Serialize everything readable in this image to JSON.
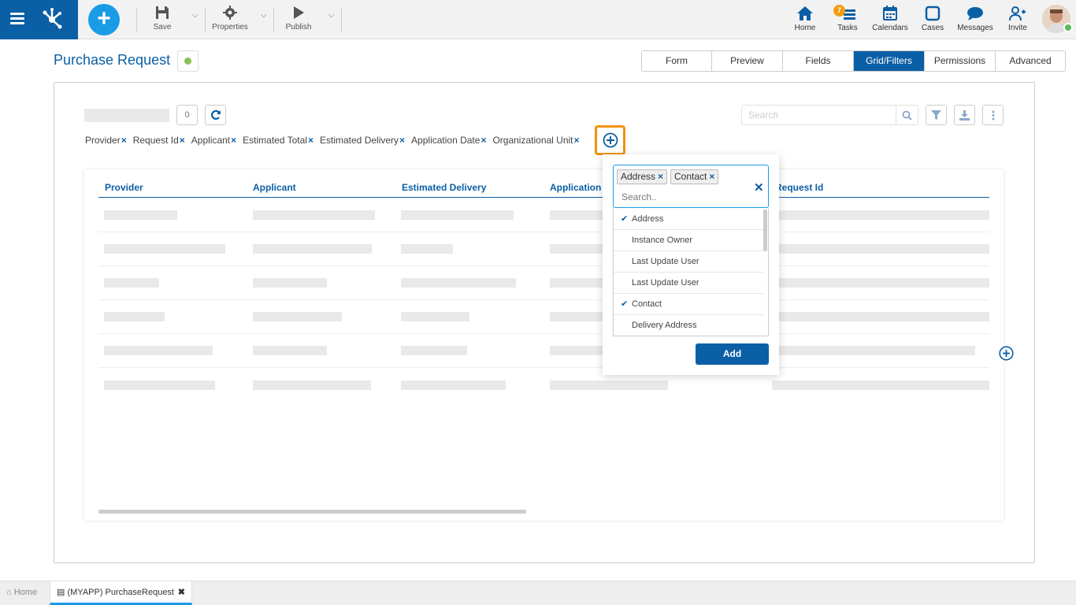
{
  "toolbar": {
    "save": "Save",
    "properties": "Properties",
    "publish": "Publish"
  },
  "top_nav": {
    "home": "Home",
    "tasks": "Tasks",
    "tasks_badge": "7",
    "calendars": "Calendars",
    "cases": "Cases",
    "messages": "Messages",
    "invite": "Invite"
  },
  "page": {
    "title": "Purchase Request",
    "status_color": "#8cc152"
  },
  "tabs": [
    "Form",
    "Preview",
    "Fields",
    "Grid/Filters",
    "Permissions",
    "Advanced"
  ],
  "active_tab": "Grid/Filters",
  "grid": {
    "count": "0",
    "search_placeholder": "Search",
    "filter_chips": [
      "Provider",
      "Request Id",
      "Applicant",
      "Estimated Total",
      "Estimated Delivery",
      "Application Date",
      "Organizational Unit"
    ],
    "columns": [
      "Provider",
      "Applicant",
      "Estimated Delivery",
      "Application",
      "Request Id"
    ]
  },
  "dropdown": {
    "selected_tags": [
      "Address",
      "Contact"
    ],
    "search_placeholder": "Search..",
    "options": [
      {
        "label": "Address",
        "checked": true
      },
      {
        "label": "Instance Owner",
        "checked": false
      },
      {
        "label": "Last Update User",
        "checked": false
      },
      {
        "label": "Last Update User",
        "checked": false
      },
      {
        "label": "Contact",
        "checked": true
      },
      {
        "label": "Delivery Address",
        "checked": false
      }
    ],
    "add_label": "Add"
  },
  "bottom_tabs": {
    "home": "Home",
    "current": "(MYAPP) PurchaseRequest"
  },
  "colors": {
    "brand": "#0b5fa5",
    "accent": "#1a9be6",
    "highlight": "#f0920e",
    "badge": "#f39c12"
  }
}
